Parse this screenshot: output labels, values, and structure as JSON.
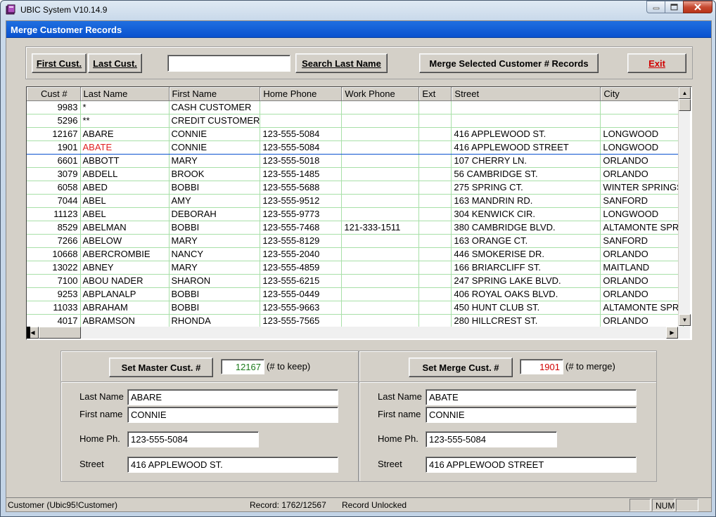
{
  "window": {
    "title": "UBIC System V10.14.9",
    "form_title": "Merge Customer Records"
  },
  "toolbar": {
    "first_cust_label": "First Cust.",
    "last_cust_label": "Last Cust.",
    "search_value": "",
    "search_btn_label": "Search Last Name",
    "merge_btn_label": "Merge Selected Customer # Records",
    "exit_label": "Exit"
  },
  "grid": {
    "columns": [
      "Cust #",
      "Last Name",
      "First Name",
      "Home Phone",
      "Work Phone",
      "Ext",
      "Street",
      "City"
    ],
    "rows": [
      {
        "cust": "9983",
        "last": "*",
        "first": "CASH CUSTOMER",
        "home": "",
        "work": "",
        "ext": "",
        "street": "",
        "city": ""
      },
      {
        "cust": "5296",
        "last": "**",
        "first": "CREDIT CUSTOMER",
        "home": "",
        "work": "",
        "ext": "",
        "street": "",
        "city": ""
      },
      {
        "cust": "12167",
        "last": "ABARE",
        "first": "CONNIE",
        "home": "123-555-5084",
        "work": "",
        "ext": "",
        "street": "416 APPLEWOOD ST.",
        "city": "LONGWOOD"
      },
      {
        "cust": "1901",
        "last": "ABATE",
        "first": "CONNIE",
        "home": "123-555-5084",
        "work": "",
        "ext": "",
        "street": "416 APPLEWOOD STREET",
        "city": "LONGWOOD"
      },
      {
        "cust": "6601",
        "last": "ABBOTT",
        "first": "MARY",
        "home": "123-555-5018",
        "work": "",
        "ext": "",
        "street": "107 CHERRY LN.",
        "city": "ORLANDO"
      },
      {
        "cust": "3079",
        "last": "ABDELL",
        "first": "BROOK",
        "home": "123-555-1485",
        "work": "",
        "ext": "",
        "street": "56 CAMBRIDGE ST.",
        "city": "ORLANDO"
      },
      {
        "cust": "6058",
        "last": "ABED",
        "first": "BOBBI",
        "home": "123-555-5688",
        "work": "",
        "ext": "",
        "street": "275 SPRING CT.",
        "city": "WINTER SPRINGS"
      },
      {
        "cust": "7044",
        "last": "ABEL",
        "first": "AMY",
        "home": "123-555-9512",
        "work": "",
        "ext": "",
        "street": "163 MANDRIN RD.",
        "city": "SANFORD"
      },
      {
        "cust": "11123",
        "last": "ABEL",
        "first": "DEBORAH",
        "home": "123-555-9773",
        "work": "",
        "ext": "",
        "street": "304 KENWICK CIR.",
        "city": "LONGWOOD"
      },
      {
        "cust": "8529",
        "last": "ABELMAN",
        "first": "BOBBI",
        "home": "123-555-7468",
        "work": "121-333-1511",
        "ext": "",
        "street": "380 CAMBRIDGE BLVD.",
        "city": "ALTAMONTE SPRI"
      },
      {
        "cust": "7266",
        "last": "ABELOW",
        "first": "MARY",
        "home": "123-555-8129",
        "work": "",
        "ext": "",
        "street": "163 ORANGE CT.",
        "city": "SANFORD"
      },
      {
        "cust": "10668",
        "last": "ABERCROMBIE",
        "first": "NANCY",
        "home": "123-555-2040",
        "work": "",
        "ext": "",
        "street": "446 SMOKERISE DR.",
        "city": "ORLANDO"
      },
      {
        "cust": "13022",
        "last": "ABNEY",
        "first": "MARY",
        "home": "123-555-4859",
        "work": "",
        "ext": "",
        "street": "166 BRIARCLIFF ST.",
        "city": "MAITLAND"
      },
      {
        "cust": "7100",
        "last": "ABOU NADER",
        "first": "SHARON",
        "home": "123-555-6215",
        "work": "",
        "ext": "",
        "street": "247 SPRING LAKE BLVD.",
        "city": "ORLANDO"
      },
      {
        "cust": "9253",
        "last": "ABPLANALP",
        "first": "BOBBI",
        "home": "123-555-0449",
        "work": "",
        "ext": "",
        "street": "406 ROYAL OAKS BLVD.",
        "city": "ORLANDO"
      },
      {
        "cust": "11033",
        "last": "ABRAHAM",
        "first": "BOBBI",
        "home": "123-555-9663",
        "work": "",
        "ext": "",
        "street": "450 HUNT CLUB ST.",
        "city": "ALTAMONTE SPRI"
      },
      {
        "cust": "4017",
        "last": "ABRAMSON",
        "first": "RHONDA",
        "home": "123-555-7565",
        "work": "",
        "ext": "",
        "street": "280 HILLCREST ST.",
        "city": "ORLANDO"
      }
    ]
  },
  "master": {
    "button_label": "Set Master Cust. #",
    "cust_num": "12167",
    "hint": "(# to keep)",
    "last_name_label": "Last Name",
    "last_name": "ABARE",
    "first_name_label": "First name",
    "first_name": "CONNIE",
    "home_ph_label": "Home Ph.",
    "home_ph": "123-555-5084",
    "street_label": "Street",
    "street": "416 APPLEWOOD ST."
  },
  "merge": {
    "button_label": "Set Merge Cust. #",
    "cust_num": "1901",
    "hint": "(# to merge)",
    "last_name_label": "Last Name",
    "last_name": "ABATE",
    "first_name_label": "First name",
    "first_name": "CONNIE",
    "home_ph_label": "Home Ph.",
    "home_ph": "123-555-5084",
    "street_label": "Street",
    "street": "416 APPLEWOOD STREET"
  },
  "statusbar": {
    "form": "Customer (Ubic95!Customer)",
    "record": "Record: 1762/12567",
    "lock": "Record Unlocked",
    "num": "NUM"
  },
  "colors": {
    "header_blue": "#0a52cf",
    "master_num": "#1a7a1a",
    "merge_num": "#d00000",
    "selected_text": "#e02020",
    "grid_lines": "#a8e0a8"
  }
}
